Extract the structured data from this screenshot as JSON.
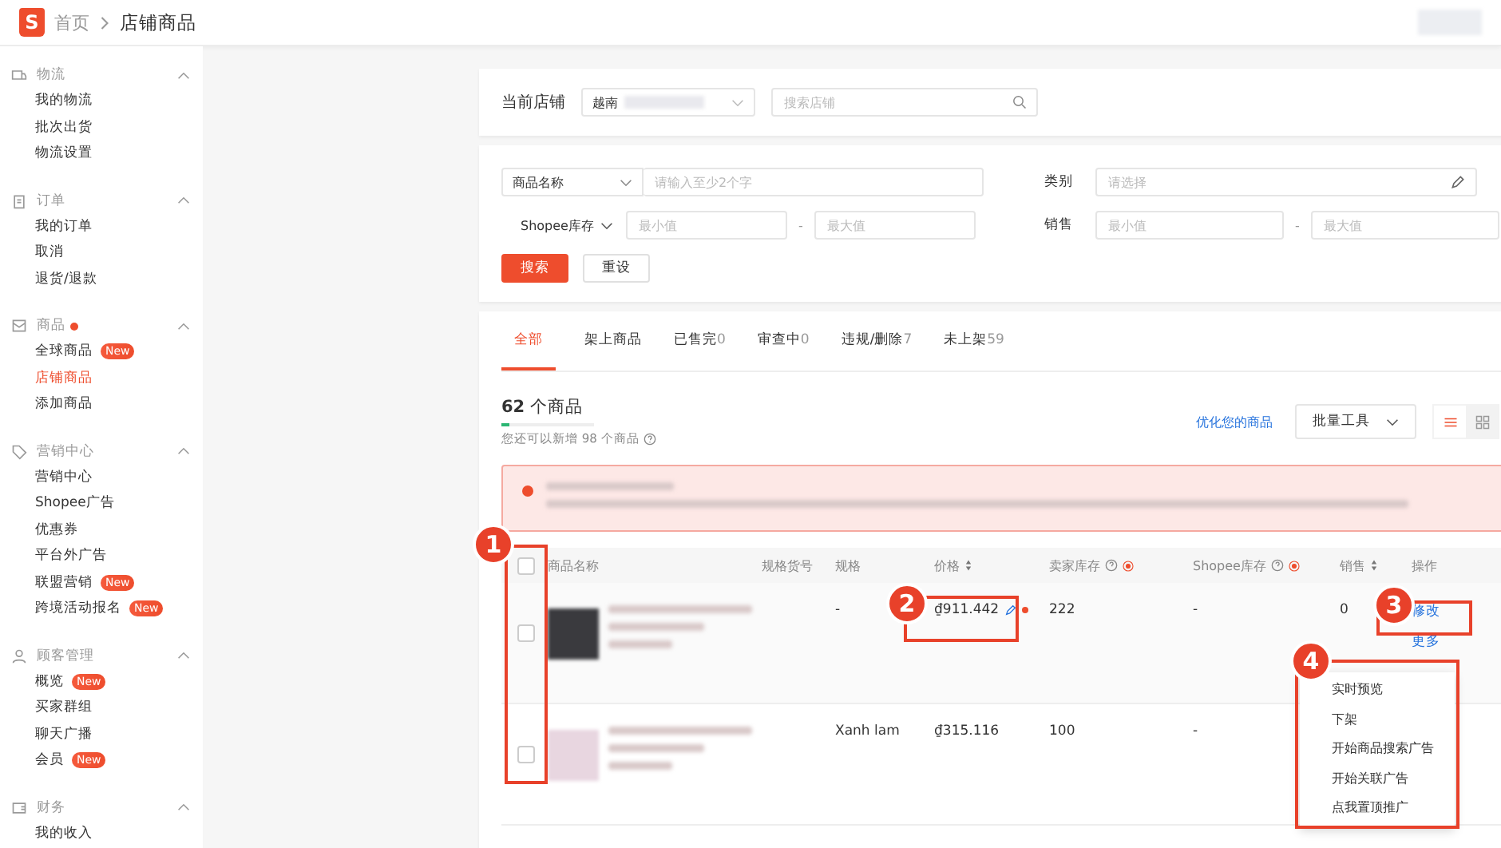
{
  "header": {
    "logo": "S",
    "breadcrumb": [
      {
        "label": "首页",
        "current": false
      },
      {
        "label": "店铺商品",
        "current": true
      }
    ]
  },
  "sidebar": {
    "groups": [
      {
        "kind": "truck",
        "title": "物流",
        "dot": false,
        "expanded": true,
        "items": [
          {
            "label": "我的物流",
            "selected": false
          },
          {
            "label": "批次出货",
            "selected": false
          },
          {
            "label": "物流设置",
            "selected": false
          }
        ]
      },
      {
        "kind": "clipboard",
        "title": "订单",
        "dot": false,
        "expanded": true,
        "items": [
          {
            "label": "我的订单",
            "selected": false
          },
          {
            "label": "取消",
            "selected": false
          },
          {
            "label": "退货/退款",
            "selected": false
          }
        ]
      },
      {
        "kind": "box",
        "title": "商品",
        "dot": true,
        "expanded": true,
        "items": [
          {
            "label": "全球商品",
            "selected": false,
            "badge": "New"
          },
          {
            "label": "店铺商品",
            "selected": true
          },
          {
            "label": "添加商品",
            "selected": false
          }
        ]
      },
      {
        "kind": "tag",
        "title": "营销中心",
        "dot": false,
        "expanded": true,
        "items": [
          {
            "label": "营销中心",
            "selected": false
          },
          {
            "label": "Shopee广告",
            "selected": false
          },
          {
            "label": "优惠券",
            "selected": false
          },
          {
            "label": "平台外广告",
            "selected": false
          },
          {
            "label": "联盟营销",
            "selected": false,
            "badge": "New"
          },
          {
            "label": "跨境活动报名",
            "selected": false,
            "badge": "New"
          }
        ]
      },
      {
        "kind": "person",
        "title": "顾客管理",
        "dot": false,
        "expanded": true,
        "items": [
          {
            "label": "概览",
            "selected": false,
            "badge": "New"
          },
          {
            "label": "买家群组",
            "selected": false
          },
          {
            "label": "聊天广播",
            "selected": false
          },
          {
            "label": "会员",
            "selected": false,
            "badge": "New"
          }
        ]
      },
      {
        "kind": "wallet",
        "title": "财务",
        "dot": false,
        "expanded": true,
        "items": [
          {
            "label": "我的收入",
            "selected": false
          }
        ]
      }
    ]
  },
  "store": {
    "label": "当前店铺",
    "region": "越南",
    "search_placeholder": "搜索店铺"
  },
  "filters": {
    "name_select": "商品名称",
    "name_placeholder": "请输入至少2个字",
    "stock_select": "Shopee库存",
    "min_placeholder": "最小值",
    "separator": "-",
    "max_placeholder": "最大值",
    "category_label": "类别",
    "category_placeholder": "请选择",
    "sales_label": "销售",
    "sales_min_placeholder": "最小值",
    "sales_separator": "-",
    "sales_max_placeholder": "最大值",
    "search_button": "搜索",
    "reset_button": "重设"
  },
  "tabs": [
    {
      "label": "全部",
      "selected": true
    },
    {
      "label": "架上商品",
      "selected": false
    },
    {
      "label": "已售完",
      "count": "0",
      "selected": false
    },
    {
      "label": "审查中",
      "count": "0",
      "selected": false
    },
    {
      "label": "违规/删除",
      "count": "7",
      "selected": false
    },
    {
      "label": "未上架",
      "count": "59",
      "selected": false
    }
  ],
  "summary": {
    "count": "62",
    "unit": "个商品",
    "quota": {
      "level": 0.08
    },
    "quota_text": "您还可以新增 98 个商品",
    "optimize_link": "优化您的商品",
    "bulk_button": "批量工具",
    "view_buttons": [
      {
        "kind": "list",
        "selected": true
      },
      {
        "kind": "grid",
        "selected": false
      }
    ]
  },
  "table": {
    "select_all_checked": false,
    "columns": [
      {
        "label": "商品名称",
        "sortable": false,
        "help": false,
        "dot": false
      },
      {
        "label": "规格货号",
        "sortable": false,
        "help": false,
        "dot": false
      },
      {
        "label": "规格",
        "sortable": false,
        "help": false,
        "dot": false
      },
      {
        "label": "价格",
        "sortable": true,
        "help": false,
        "dot": false
      },
      {
        "label": "卖家库存",
        "sortable": false,
        "help": true,
        "dot": true
      },
      {
        "label": "Shopee库存",
        "sortable": false,
        "help": true,
        "dot": true
      },
      {
        "label": "销售",
        "sortable": true,
        "help": false,
        "dot": false
      },
      {
        "label": "操作",
        "sortable": false,
        "help": false,
        "dot": false
      }
    ],
    "rows": [
      {
        "checked": false,
        "variation": "-",
        "price": "₫911.442",
        "price_editable": true,
        "seller_stock": "222",
        "shopee_stock": "-",
        "sales": "0",
        "actions": [
          "修改",
          "更多"
        ]
      },
      {
        "checked": false,
        "variation": "Xanh lam",
        "price": "₫315.116",
        "price_editable": false,
        "seller_stock": "100",
        "shopee_stock": "-"
      }
    ]
  },
  "more_menu": {
    "items": [
      "实时预览",
      "下架",
      "开始商品搜索广告",
      "开始关联广告",
      "点我置顶推广"
    ]
  },
  "annotations": [
    "1",
    "2",
    "3",
    "4"
  ]
}
